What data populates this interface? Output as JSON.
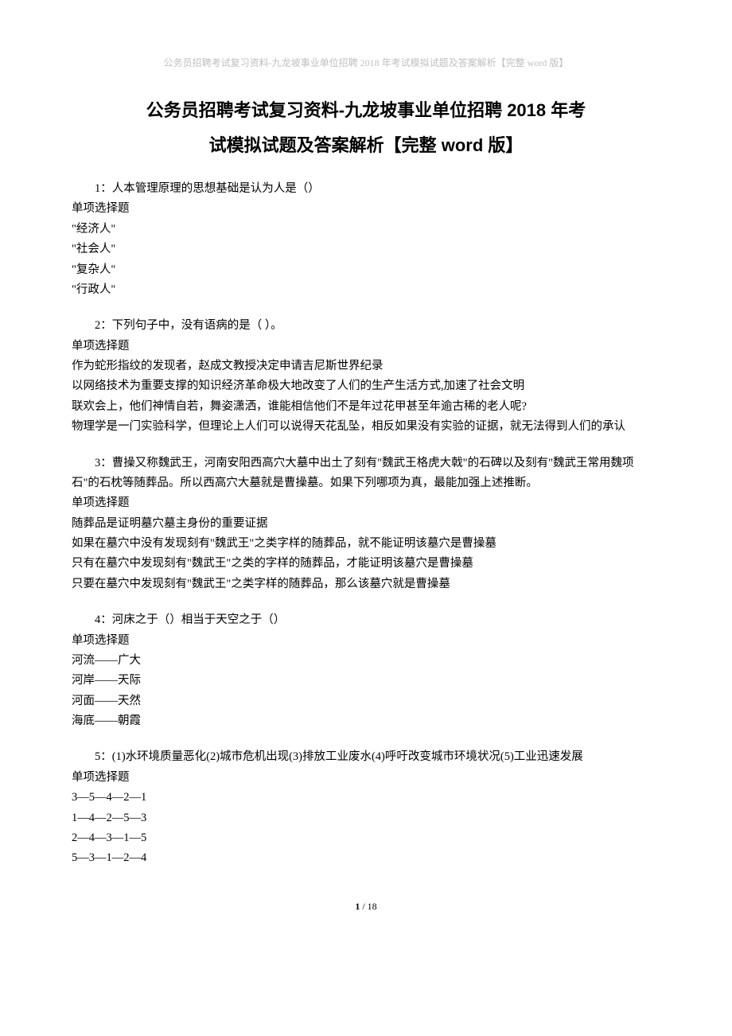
{
  "header_note": "公务员招聘考试复习资料-九龙坡事业单位招聘 2018 年考试模拟试题及答案解析【完整 word 版】",
  "title_line1": "公务员招聘考试复习资料-九龙坡事业单位招聘 2018 年考",
  "title_line2": "试模拟试题及答案解析【完整 word 版】",
  "questions": [
    {
      "prompt": "1：人本管理原理的思想基础是认为人是（）",
      "type": "单项选择题",
      "options": [
        "\"经济人\"",
        "\"社会人\"",
        "\"复杂人\"",
        "\"行政人\""
      ]
    },
    {
      "prompt": "2：下列句子中，没有语病的是（  ）。",
      "type": "单项选择题",
      "options": [
        "作为蛇形指纹的发现者，赵成文教授决定申请吉尼斯世界纪录",
        "以网络技术为重要支撑的知识经济革命极大地改变了人们的生产生活方式,加速了社会文明",
        "联欢会上，他们神情自若，舞姿潇洒，谁能相信他们不是年过花甲甚至年逾古稀的老人呢?",
        "物理学是一门实验科学，但理论上人们可以说得天花乱坠，相反如果没有实验的证据，就无法得到人们的承认"
      ]
    },
    {
      "prompt": "3：曹操又称魏武王，河南安阳西高穴大墓中出土了刻有\"魏武王格虎大戟\"的石碑以及刻有\"魏武王常用魏项石\"的石枕等随葬品。所以西高穴大墓就是曹操墓。如果下列哪项为真，最能加强上述推断。",
      "type": "单项选择题",
      "options": [
        "随葬品是证明墓穴墓主身份的重要证据",
        "如果在墓穴中没有发现刻有\"魏武王\"之类字样的随葬品，就不能证明该墓穴是曹操墓",
        "只有在墓穴中发现刻有\"魏武王\"之类的字样的随葬品，才能证明该墓穴是曹操墓",
        "只要在墓穴中发现刻有\"魏武王\"之类字样的随葬品，那么该墓穴就是曹操墓"
      ]
    },
    {
      "prompt": "4：河床之于（）相当于天空之于（）",
      "type": "单项选择题",
      "options": [
        "河流——广大",
        "河岸——天际",
        "河面——天然",
        "海底——朝霞"
      ]
    },
    {
      "prompt": "5：(1)水环境质量恶化(2)城市危机出现(3)排放工业废水(4)呼吁改变城市环境状况(5)工业迅速发展",
      "type": "单项选择题",
      "options": [
        "3—5—4—2—1",
        "1—4—2—5—3",
        "2—4—3—1—5",
        "5—3—1—2—4"
      ]
    }
  ],
  "page_current": "1",
  "page_total": "18"
}
